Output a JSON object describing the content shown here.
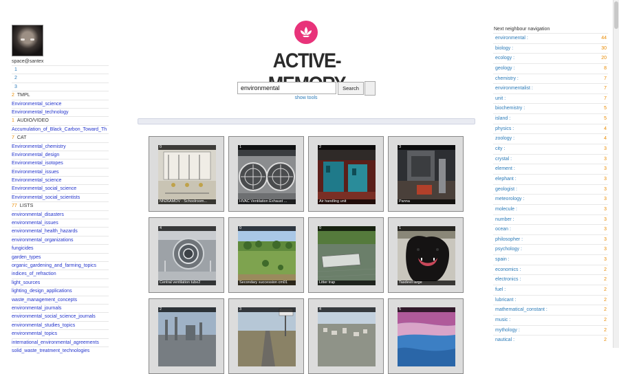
{
  "user": {
    "name": "space@santex"
  },
  "left": {
    "pages": [
      "1",
      "2",
      "3"
    ],
    "sections": [
      {
        "count": "2",
        "label": "TMPL",
        "items": [
          "Environmental_science",
          "Environmental_technology"
        ]
      },
      {
        "count": "1",
        "label": "AUDIO/VIDEO",
        "items": [
          "Accumulation_of_Black_Carbon_Toward_Th"
        ]
      },
      {
        "count": "7",
        "label": "CAT",
        "items": [
          "Environmental_chemistry",
          "Environmental_design",
          "Environmental_isotopes",
          "Environmental_issues",
          "Environmental_science",
          "Environmental_social_science",
          "Environmental_social_scientists"
        ]
      },
      {
        "count": "77",
        "label": "LISTS",
        "items": [
          "environmental_disasters",
          "environmental_issues",
          "environmental_health_hazards",
          "environmental_organizations",
          "fungicides",
          "garden_types",
          "organic_gardening_and_farming_topics",
          "indices_of_refraction",
          "light_sources",
          "lighting_design_applications",
          "waste_management_concepts",
          "environmental_journals",
          "environmental_social_science_journals",
          "environmental_studies_topics",
          "environmental_topics",
          "international_environmental_agreements",
          "solid_waste_treatment_technologies"
        ]
      }
    ]
  },
  "header": {
    "title": "ACTIVE-MEMORY",
    "logo_icon": "lotus-icon"
  },
  "search": {
    "value": "environmental",
    "button": "Search",
    "tools_link": "show tools"
  },
  "tiles": [
    {
      "num": "0",
      "caption": "NN26AMOV - Schoolroom...",
      "theme": "schoolroom"
    },
    {
      "num": "1",
      "caption": "HVAC Ventilation Exhaust ...",
      "theme": "fans"
    },
    {
      "num": "2",
      "caption": "Air handling unit",
      "theme": "airunit"
    },
    {
      "num": "3",
      "caption": "Panna",
      "theme": "panna"
    },
    {
      "num": "4",
      "caption": "Central ventilation tube2",
      "theme": "tube"
    },
    {
      "num": "0",
      "caption": "Secondary succession cm01",
      "theme": "field"
    },
    {
      "num": "0",
      "caption": "Litter trap",
      "theme": "trap"
    },
    {
      "num": "1",
      "caption": "Tasdevil large",
      "theme": "devil"
    },
    {
      "num": "2",
      "caption": "",
      "theme": "industry"
    },
    {
      "num": "3",
      "caption": "",
      "theme": "road"
    },
    {
      "num": "4",
      "caption": "",
      "theme": "city"
    },
    {
      "num": "5",
      "caption": "",
      "theme": "satellite"
    }
  ],
  "right": {
    "heading": "Next neighbour navigation",
    "keywords": [
      {
        "word": "environmental",
        "count": "44"
      },
      {
        "word": "biology",
        "count": "30"
      },
      {
        "word": "ecology",
        "count": "20"
      },
      {
        "word": "geology",
        "count": "8"
      },
      {
        "word": "chemistry",
        "count": "7"
      },
      {
        "word": "environmentalist",
        "count": "7"
      },
      {
        "word": "unit",
        "count": "7"
      },
      {
        "word": "biochemistry",
        "count": "5"
      },
      {
        "word": "island",
        "count": "5"
      },
      {
        "word": "physics",
        "count": "4"
      },
      {
        "word": "zoology",
        "count": "4"
      },
      {
        "word": "city",
        "count": "3"
      },
      {
        "word": "crystal",
        "count": "3"
      },
      {
        "word": "element",
        "count": "3"
      },
      {
        "word": "elephant",
        "count": "3"
      },
      {
        "word": "geologist",
        "count": "3"
      },
      {
        "word": "meteorology",
        "count": "3"
      },
      {
        "word": "molecule",
        "count": "3"
      },
      {
        "word": "number",
        "count": "3"
      },
      {
        "word": "ocean",
        "count": "3"
      },
      {
        "word": "philosopher",
        "count": "3"
      },
      {
        "word": "psychology",
        "count": "3"
      },
      {
        "word": "spain",
        "count": "3"
      },
      {
        "word": "economics",
        "count": "2"
      },
      {
        "word": "electronics",
        "count": "2"
      },
      {
        "word": "fuel",
        "count": "2"
      },
      {
        "word": "lubricant",
        "count": "2"
      },
      {
        "word": "mathematical_constant",
        "count": "2"
      },
      {
        "word": "music",
        "count": "2"
      },
      {
        "word": "mythology",
        "count": "2"
      },
      {
        "word": "nautical",
        "count": "2"
      }
    ]
  },
  "colors": {
    "accent": "#e8337a",
    "link": "#2233cc",
    "keyword": "#2a7ab8",
    "count": "#e98a00"
  }
}
